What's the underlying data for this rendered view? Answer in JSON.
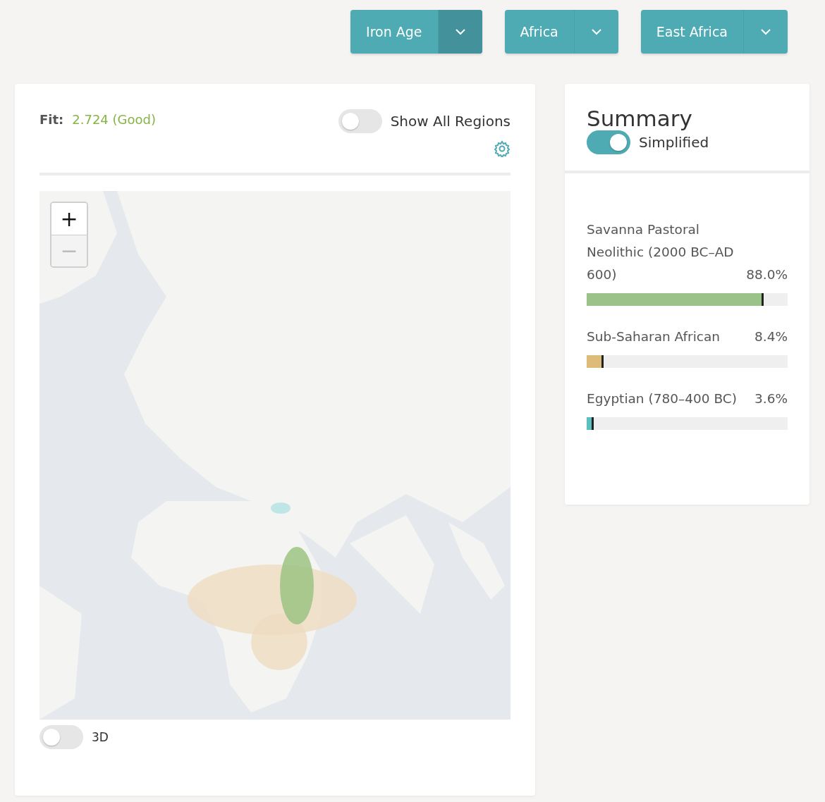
{
  "filters": [
    {
      "label": "Iron Age",
      "active": true
    },
    {
      "label": "Africa",
      "active": false
    },
    {
      "label": "East Africa",
      "active": false
    }
  ],
  "fit": {
    "label": "Fit:",
    "value": "2.724 (Good)"
  },
  "show_all_regions": {
    "label": "Show All Regions",
    "on": false
  },
  "map": {
    "zoom_in": {
      "label": "+",
      "disabled": false
    },
    "zoom_out": {
      "label": "−",
      "disabled": true
    }
  },
  "toggle_3d": {
    "label": "3D",
    "on": false
  },
  "summary": {
    "title": "Summary",
    "simplified": {
      "label": "Simplified",
      "on": true
    },
    "components": [
      {
        "name": "Savanna Pastoral Neolithic (2000 BC–AD 600)",
        "percent": "88.0%",
        "level": 0.88,
        "color": "#9bc288"
      },
      {
        "name": "Sub-Saharan African",
        "percent": "8.4%",
        "level": 0.084,
        "color": "#dfbb7a"
      },
      {
        "name": "Egyptian (780–400 BC)",
        "percent": "3.6%",
        "level": 0.036,
        "color": "#5bbfc0"
      }
    ]
  }
}
